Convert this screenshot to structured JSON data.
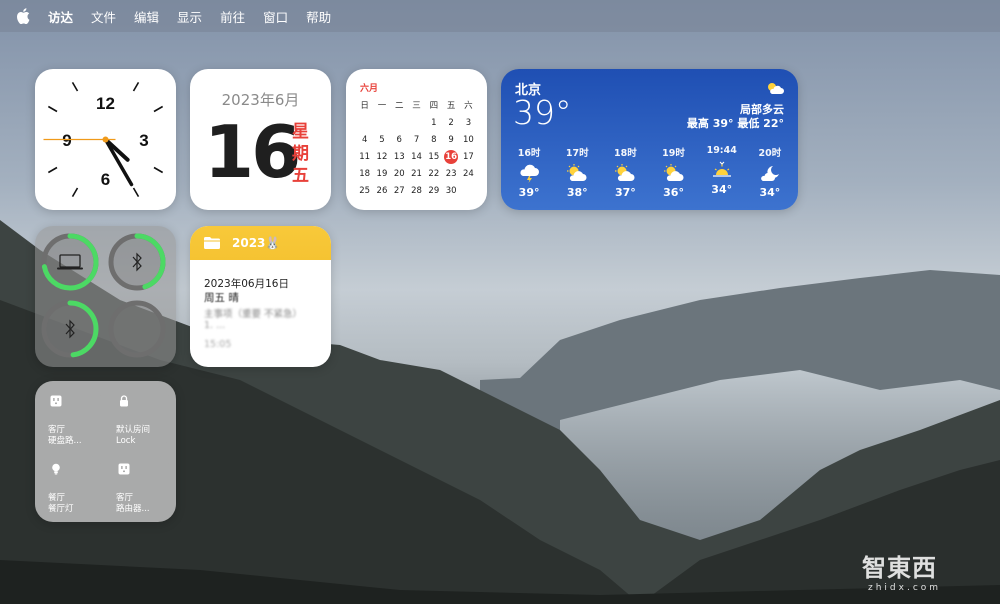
{
  "menubar": {
    "items": [
      "访达",
      "文件",
      "编辑",
      "显示",
      "前往",
      "窗口",
      "帮助"
    ]
  },
  "clock": {
    "numerals": [
      "12",
      "3",
      "6",
      "9"
    ],
    "hour": 4,
    "minute": 25,
    "second": 45
  },
  "date_widget": {
    "year_month": "2023年6月",
    "day": "16",
    "weekday_chars": [
      "星",
      "期",
      "五"
    ]
  },
  "calendar": {
    "month": "六月",
    "weekdays": [
      "日",
      "一",
      "二",
      "三",
      "四",
      "五",
      "六"
    ],
    "leading_blanks": 4,
    "days": [
      "1",
      "2",
      "3",
      "4",
      "5",
      "6",
      "7",
      "8",
      "9",
      "10",
      "11",
      "12",
      "13",
      "14",
      "15",
      "16",
      "17",
      "18",
      "19",
      "20",
      "21",
      "22",
      "23",
      "24",
      "25",
      "26",
      "27",
      "28",
      "29",
      "30"
    ],
    "today": "16"
  },
  "weather": {
    "city": "北京",
    "temp": "39°",
    "condition": "局部多云",
    "high_low": "最高 39° 最低 22°",
    "hourly": [
      {
        "time": "16时",
        "icon": "thunder-cloud-icon",
        "temp": "39°"
      },
      {
        "time": "17时",
        "icon": "partly-cloudy-icon",
        "temp": "38°"
      },
      {
        "time": "18时",
        "icon": "partly-cloudy-icon",
        "temp": "37°"
      },
      {
        "time": "19时",
        "icon": "partly-cloudy-icon",
        "temp": "36°"
      },
      {
        "time": "19:44",
        "icon": "sunset-icon",
        "temp": "34°"
      },
      {
        "time": "20时",
        "icon": "moon-cloud-icon",
        "temp": "34°"
      }
    ]
  },
  "batteries": {
    "items": [
      {
        "icon": "laptop-icon",
        "level": 0.72
      },
      {
        "icon": "bluetooth-icon",
        "level": 0.45
      },
      {
        "icon": "bluetooth-icon",
        "level": 0.48
      },
      {
        "icon": "empty-icon",
        "level": 0
      }
    ],
    "colors": {
      "ring": "#4cd964",
      "track": "#6e6e6e"
    }
  },
  "notes": {
    "folder": "2023🐰",
    "title": "2023年06月16日",
    "line2": "周五 晴",
    "line3": "主事项（重要 不紧急）",
    "line4": "1. ...",
    "time": "15:05"
  },
  "home": {
    "tiles": [
      {
        "icon": "outlet-icon",
        "room": "客厅",
        "device": "硬盘路..."
      },
      {
        "icon": "lock-icon",
        "room": "默认房间",
        "device": "Lock"
      },
      {
        "icon": "bulb-icon",
        "room": "餐厅",
        "device": "餐厅灯"
      },
      {
        "icon": "outlet-icon",
        "room": "客厅",
        "device": "路由器..."
      }
    ]
  },
  "watermark": {
    "logo": "智東西",
    "url": "zhidx.com"
  }
}
